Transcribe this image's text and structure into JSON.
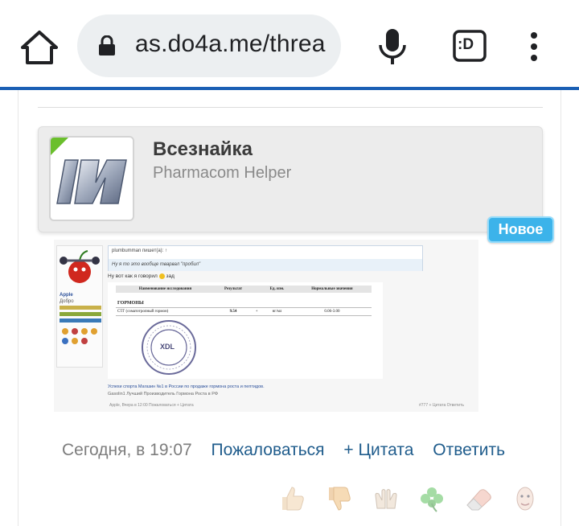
{
  "browser": {
    "url": "as.do4a.me/threa",
    "tab_label": ":D",
    "icons": [
      "home-icon",
      "lock-icon",
      "microphone-icon",
      "tab-switcher-icon",
      "overflow-menu-icon"
    ]
  },
  "author": {
    "name": "Всезнайка",
    "title": "Pharmacom Helper",
    "badge": "Новое",
    "colors": {
      "online": "#6abf2c",
      "badge": "#3cb3ea"
    }
  },
  "embedded_image": {
    "sidebar_name": "Apple",
    "sidebar_role": "Добро",
    "quote_line1": "plumbumman пишет(а): ↑",
    "quote_line2": "Ну я то это вообще тварвал \"пробил\"",
    "post_line": "Ну вот как я говорил",
    "post_smile_text": "зад",
    "table_headers": [
      "Наименование исследования",
      "Результат",
      "",
      "Ед. изм.",
      "Нормальные значения"
    ],
    "table_section": "ГОРМОНЫ",
    "table_row": [
      "СТГ (соматотропный гормон)",
      "9.54",
      "+",
      "нг/мл",
      "0.06-3.00"
    ],
    "stamp_text": "XDL",
    "footer_link": "Успехи спорта Магазин №1 в России по продаже гормона роста и пептидов.",
    "footer_sig": "Gasolin1 Лучший Производитель Гормона Роста в РФ",
    "footer_meta": "Apple, Вчера в 12:00   Пожаловаться   + Цитата",
    "footer_post": "#777   + Цитата   Ответить"
  },
  "post": {
    "timestamp": "Сегодня, в 19:07",
    "report_label": "Пожаловаться",
    "quote_label": "+ Цитата",
    "reply_label": "Ответить"
  },
  "reactions": [
    "like",
    "dislike",
    "applause",
    "clover",
    "eraser",
    "face"
  ]
}
